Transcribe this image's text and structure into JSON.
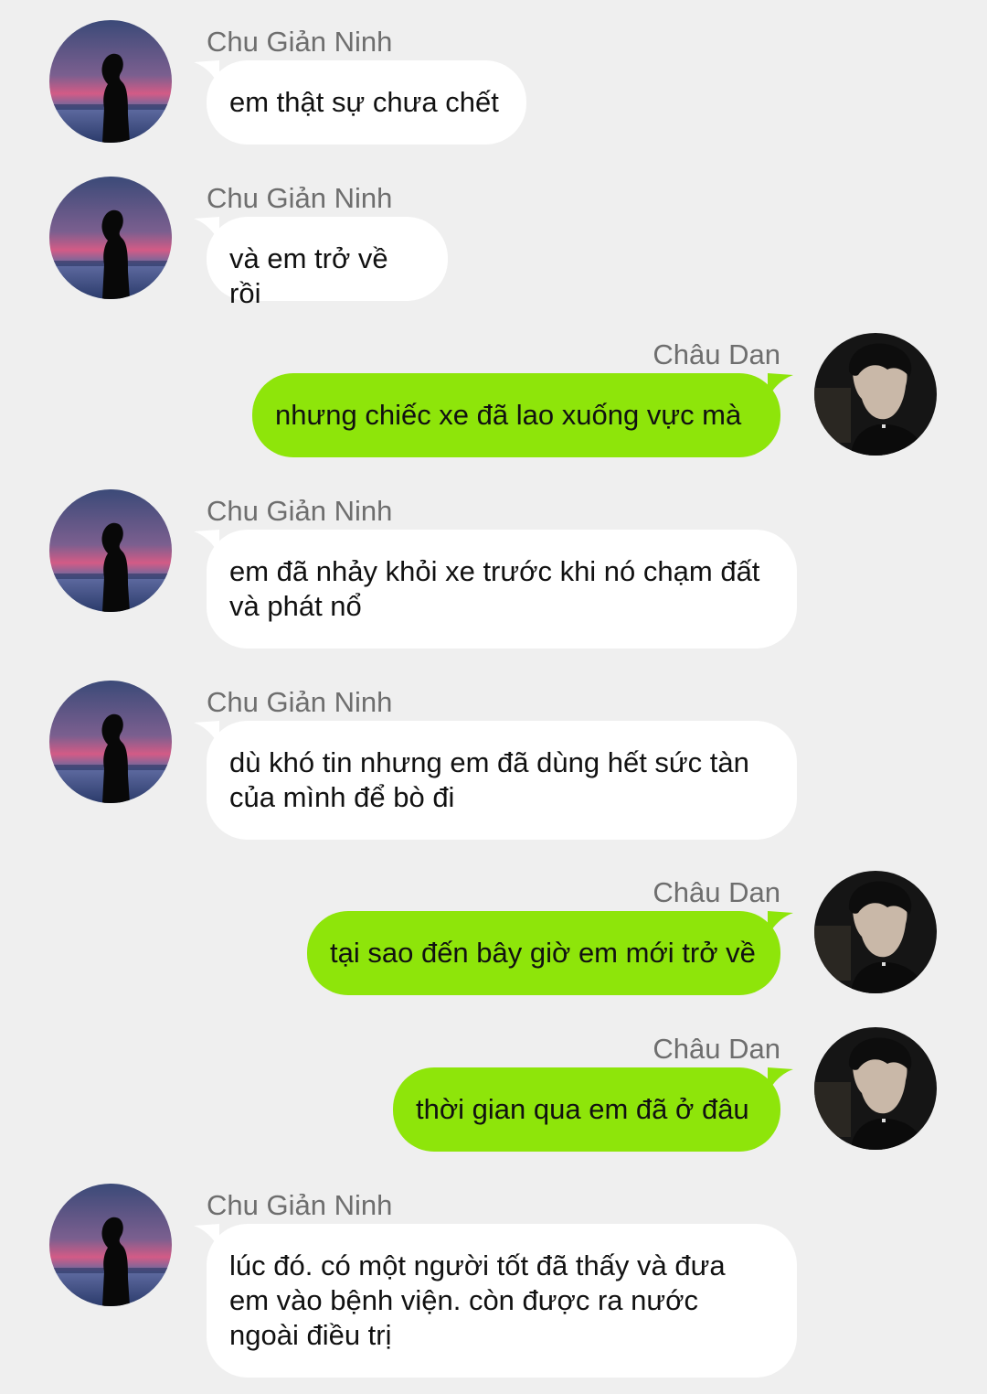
{
  "colors": {
    "background": "#efefef",
    "incoming_bubble": "#ffffff",
    "outgoing_bubble": "#8ee50a",
    "sender_name": "#6e6e6e",
    "text": "#111111"
  },
  "messages": [
    {
      "side": "left",
      "sender": "Chu Giản Ninh",
      "avatar": "silhouette-sunset-avatar",
      "text": "em thật sự chưa chết"
    },
    {
      "side": "left",
      "sender": "Chu Giản Ninh",
      "avatar": "silhouette-sunset-avatar",
      "text": "và em trở về rồi"
    },
    {
      "side": "right",
      "sender": "Châu Dan",
      "avatar": "dark-portrait-avatar",
      "text": "nhưng chiếc xe đã lao xuống vực mà"
    },
    {
      "side": "left",
      "sender": "Chu Giản Ninh",
      "avatar": "silhouette-sunset-avatar",
      "text": "em đã nhảy khỏi xe trước khi nó chạm đất\nvà phát nổ"
    },
    {
      "side": "left",
      "sender": "Chu Giản Ninh",
      "avatar": "silhouette-sunset-avatar",
      "text": "dù khó tin nhưng em đã dùng hết sức tàn\ncủa mình để bò đi"
    },
    {
      "side": "right",
      "sender": "Châu Dan",
      "avatar": "dark-portrait-avatar",
      "text": "tại sao đến bây giờ em mới trở về"
    },
    {
      "side": "right",
      "sender": "Châu Dan",
      "avatar": "dark-portrait-avatar",
      "text": "thời gian qua em đã ở đâu"
    },
    {
      "side": "left",
      "sender": "Chu Giản Ninh",
      "avatar": "silhouette-sunset-avatar",
      "text": "lúc đó. có một người tốt đã thấy và đưa\nem vào bệnh viện. còn được ra nước\nngoài điều trị"
    }
  ]
}
